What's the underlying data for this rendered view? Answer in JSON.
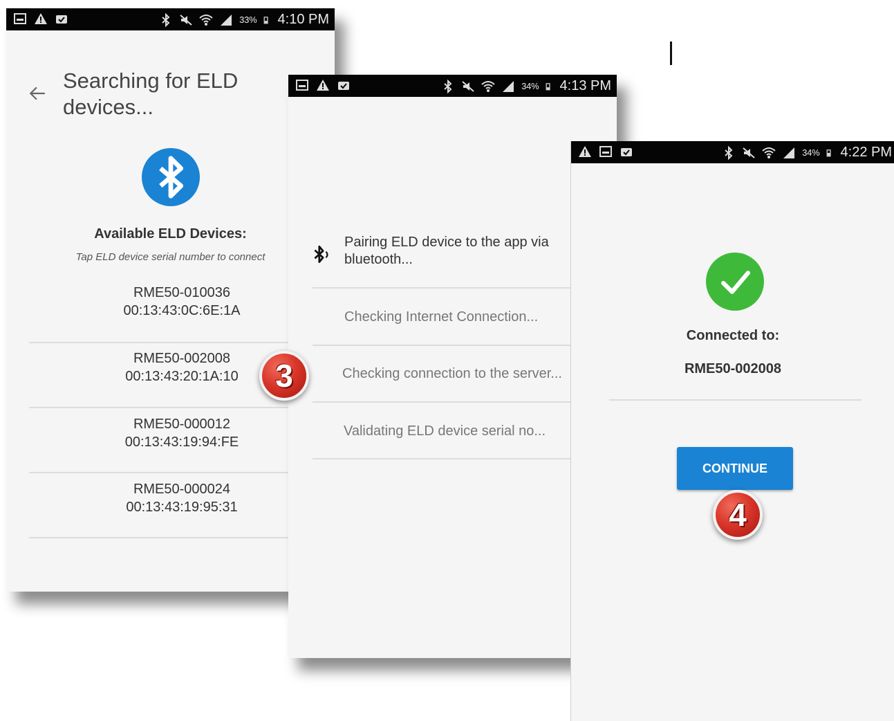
{
  "screen1": {
    "status": {
      "battery": "33%",
      "time": "4:10 PM"
    },
    "title": "Searching for ELD devices...",
    "heading": "Available ELD Devices:",
    "hint": "Tap ELD device serial number to connect",
    "devices": [
      {
        "serial": "RME50-010036",
        "mac": "00:13:43:0C:6E:1A"
      },
      {
        "serial": "RME50-002008",
        "mac": "00:13:43:20:1A:10"
      },
      {
        "serial": "RME50-000012",
        "mac": "00:13:43:19:94:FE"
      },
      {
        "serial": "RME50-000024",
        "mac": "00:13:43:19:95:31"
      }
    ]
  },
  "screen2": {
    "status": {
      "battery": "34%",
      "time": "4:13 PM"
    },
    "steps": [
      "Pairing ELD device to the app via bluetooth...",
      "Checking Internet Connection...",
      "Checking connection to the server...",
      "Validating ELD device serial no..."
    ]
  },
  "screen3": {
    "status": {
      "battery": "34%",
      "time": "4:22 PM"
    },
    "connected_label": "Connected to:",
    "device": "RME50-002008",
    "continue_label": "CONTINUE"
  },
  "badges": {
    "step3": "3",
    "step4": "4"
  },
  "colors": {
    "accent": "#1a83d4",
    "success": "#3fb93a",
    "badge": "#d9362a"
  }
}
